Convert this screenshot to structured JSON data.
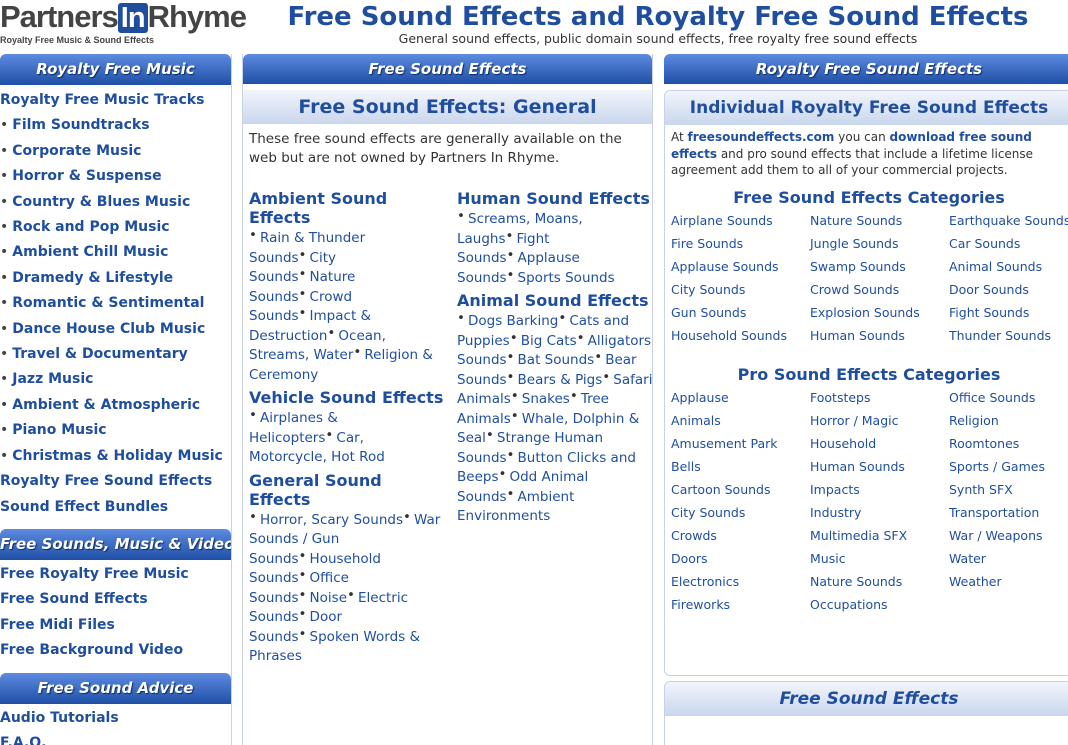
{
  "header": {
    "logo_main_a": "Partners",
    "logo_main_in": "In",
    "logo_main_b": "Rhyme",
    "logo_tag": "Royalty Free Music & Sound Effects",
    "title": "Free Sound Effects and Royalty Free Sound Effects",
    "subtitle": "General sound effects, public domain sound effects, free royalty free sound effects"
  },
  "left": {
    "bar1": "Royalty Free Music",
    "music_tracks": "Royalty Free Music Tracks",
    "music_items": [
      "Film Soundtracks",
      "Corporate Music",
      "Horror & Suspense",
      "Country & Blues Music",
      "Rock and Pop Music",
      "Ambient Chill Music",
      "Dramedy & Lifestyle",
      "Romantic & Sentimental",
      "Dance House Club Music",
      "Travel & Documentary",
      "Jazz Music",
      "Ambient & Atmospheric",
      "Piano Music",
      "Christmas & Holiday Music"
    ],
    "royalty_sfx": "Royalty Free Sound Effects",
    "bundles": "Sound Effect Bundles",
    "bar2": "Free Sounds, Music & Video",
    "free_links": [
      "Free Royalty Free Music",
      "Free Sound Effects",
      "Free Midi Files",
      "Free Background Video"
    ],
    "bar3": "Free Sound Advice",
    "advice_links": [
      "Audio Tutorials",
      "F.A.Q."
    ]
  },
  "mid": {
    "bar": "Free Sound Effects",
    "heading": "Free Sound Effects: General",
    "intro": "These free sound effects are generally available on the web but are not owned by Partners In Rhyme.",
    "col1": [
      {
        "head": "Ambient Sound Effects",
        "items": [
          "Rain & Thunder Sounds",
          "City Sounds",
          "Nature Sounds",
          "Crowd Sounds",
          "Impact & Destruction",
          "Ocean, Streams, Water",
          "Religion & Ceremony"
        ]
      },
      {
        "head": "Vehicle Sound Effects",
        "items": [
          "Airplanes & Helicopters",
          "Car, Motorcycle, Hot Rod"
        ]
      },
      {
        "head": "General Sound Effects",
        "items": [
          "Horror, Scary Sounds",
          "War Sounds / Gun Sounds",
          "Household Sounds",
          "Office Sounds",
          "Noise",
          "Electric Sounds",
          "Door Sounds",
          "Spoken Words & Phrases"
        ]
      }
    ],
    "col2": [
      {
        "head": "Human Sound Effects",
        "items": [
          "Screams, Moans, Laughs",
          "Fight Sounds",
          "Applause Sounds",
          "Sports Sounds"
        ]
      },
      {
        "head": "Animal Sound Effects",
        "items": [
          "Dogs Barking",
          "Cats and Puppies",
          "Big Cats",
          "Alligators Sounds",
          "Bat Sounds",
          "Bear Sounds",
          "Bears & Pigs",
          "Safari Animals",
          "Snakes",
          "Tree Animals",
          "Whale, Dolphin & Seal",
          "Strange Human Sounds",
          "Button Clicks and Beeps",
          "Odd Animal Sounds",
          "Ambient Environments"
        ]
      }
    ]
  },
  "right": {
    "bar": "Royalty Free Sound Effects",
    "heading": "Individual Royalty Free Sound Effects",
    "note_at": "At",
    "note_site": "freesoundeffects.com",
    "note_mid": "you can",
    "note_link": "download free sound effects",
    "note_rest": "and pro sound effects that include a lifetime license agreement add them to all of your commercial projects.",
    "free_title": "Free Sound Effects Categories",
    "free_cols": [
      [
        "Airplane Sounds",
        "Fire Sounds",
        "Applause Sounds",
        "City Sounds",
        "Gun Sounds",
        "Household Sounds"
      ],
      [
        "Nature Sounds",
        "Jungle Sounds",
        "Swamp Sounds",
        "Crowd Sounds",
        "Explosion Sounds",
        "Human Sounds"
      ],
      [
        "Earthquake Sounds",
        "Car Sounds",
        "Animal Sounds",
        "Door Sounds",
        "Fight Sounds",
        "Thunder Sounds"
      ]
    ],
    "pro_title": "Pro Sound Effects Categories",
    "pro_cols": [
      [
        "Applause",
        "Animals",
        "Amusement Park",
        "Bells",
        "Cartoon Sounds",
        "City Sounds",
        "Crowds",
        "Doors",
        "Electronics",
        "Fireworks"
      ],
      [
        "Footsteps",
        "Horror / Magic",
        "Household",
        "Human Sounds",
        "Impacts",
        "Industry",
        "Multimedia SFX",
        "Music",
        "Nature Sounds",
        "Occupations"
      ],
      [
        "Office Sounds",
        "Religion",
        "Roomtones",
        "Sports / Games",
        "Synth SFX",
        "Transportation",
        "War / Weapons",
        "Water",
        "Weather"
      ]
    ],
    "bottom_heading": "Free Sound Effects"
  }
}
